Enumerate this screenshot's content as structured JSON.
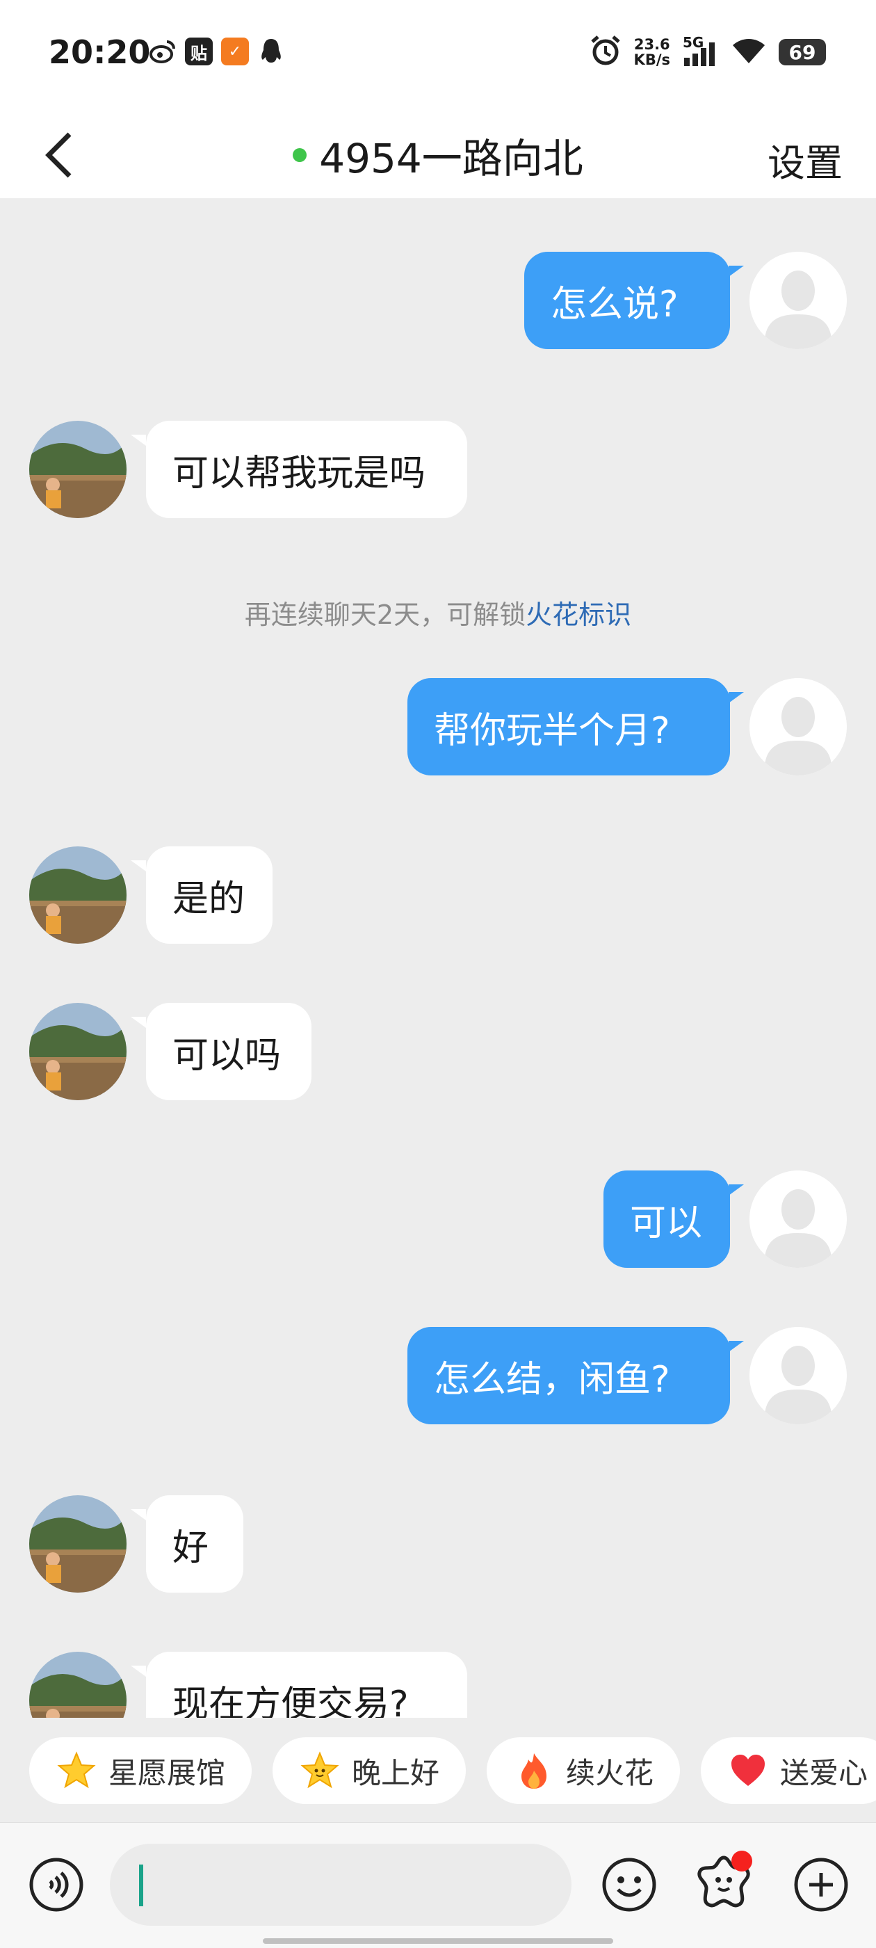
{
  "status_bar": {
    "time": "20:20",
    "net_speed_value": "23.6",
    "net_speed_unit": "KB/s",
    "network": "5G",
    "battery": "69"
  },
  "header": {
    "back_icon": "chevron-left-icon",
    "title": "4954一路向北",
    "online_color": "#3fc54b",
    "settings_label": "设置"
  },
  "messages": [
    {
      "from": "me",
      "text": "怎么说?"
    },
    {
      "from": "them",
      "text": "可以帮我玩是吗"
    },
    {
      "from": "system",
      "text": "再连续聊天2天，可解锁",
      "link": "火花标识"
    },
    {
      "from": "me",
      "text": "帮你玩半个月?"
    },
    {
      "from": "them",
      "text": "是的"
    },
    {
      "from": "them",
      "text": "可以吗"
    },
    {
      "from": "me",
      "text": "可以"
    },
    {
      "from": "me",
      "text": "怎么结，闲鱼?"
    },
    {
      "from": "them",
      "text": "好"
    },
    {
      "from": "them",
      "text": "现在方便交易?"
    }
  ],
  "quick_chips": [
    {
      "icon": "star-icon",
      "label": "星愿展馆"
    },
    {
      "icon": "star-face-icon",
      "label": "晚上好"
    },
    {
      "icon": "flame-icon",
      "label": "续火花"
    },
    {
      "icon": "heart-icon",
      "label": "送爱心"
    }
  ],
  "input_bar": {
    "voice_icon": "voice-icon",
    "text_value": "",
    "emoji_icon": "emoji-icon",
    "sticker_icon": "sticker-icon",
    "plus_icon": "plus-icon"
  },
  "colors": {
    "outgoing_bubble": "#3d9ff7",
    "incoming_bubble": "#ffffff",
    "background": "#ededed",
    "link": "#2e6bb5"
  }
}
